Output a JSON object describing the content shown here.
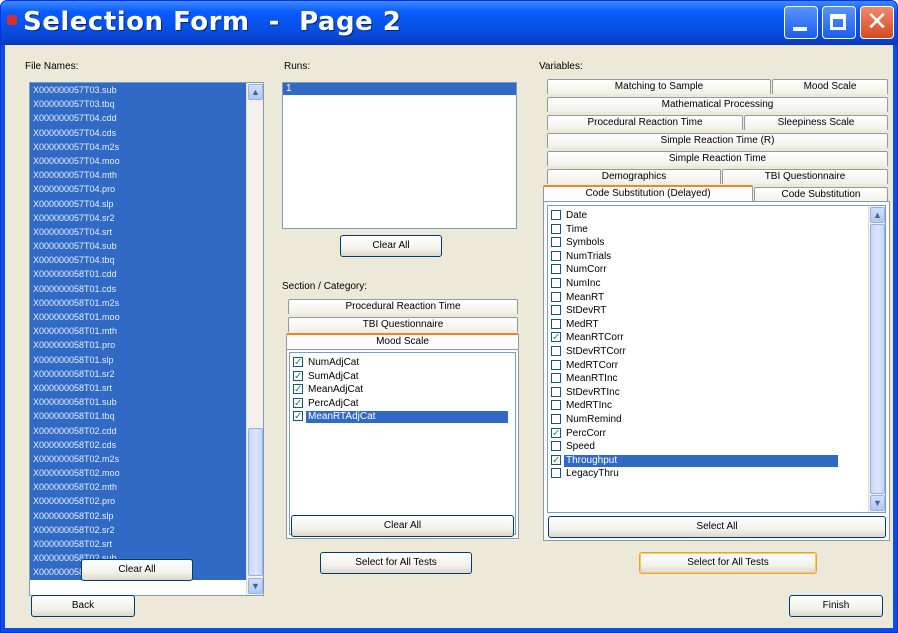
{
  "window": {
    "title": "Selection Form  -  Page 2"
  },
  "files": {
    "label": "File Names:",
    "items": [
      "X000000057T03.sub",
      "X000000057T03.tbq",
      "X000000057T04.cdd",
      "X000000057T04.cds",
      "X000000057T04.m2s",
      "X000000057T04.moo",
      "X000000057T04.mth",
      "X000000057T04.pro",
      "X000000057T04.slp",
      "X000000057T04.sr2",
      "X000000057T04.srt",
      "X000000057T04.sub",
      "X000000057T04.tbq",
      "X000000058T01.cdd",
      "X000000058T01.cds",
      "X000000058T01.m2s",
      "X000000058T01.moo",
      "X000000058T01.mth",
      "X000000058T01.pro",
      "X000000058T01.slp",
      "X000000058T01.sr2",
      "X000000058T01.srt",
      "X000000058T01.sub",
      "X000000058T01.tbq",
      "X000000058T02.cdd",
      "X000000058T02.cds",
      "X000000058T02.m2s",
      "X000000058T02.moo",
      "X000000058T02.mth",
      "X000000058T02.pro",
      "X000000058T02.slp",
      "X000000058T02.sr2",
      "X000000058T02.srt",
      "X000000058T02.sub",
      "X000000058T02.tbq"
    ],
    "clear_label": "Clear All"
  },
  "runs": {
    "label": "Runs:",
    "items": [
      "1"
    ],
    "clear_label": "Clear All"
  },
  "section": {
    "label": "Section / Category:",
    "tabs": [
      "Procedural Reaction Time",
      "TBI Questionnaire",
      "Mood Scale"
    ],
    "items": [
      {
        "label": "NumAdjCat",
        "checked": true
      },
      {
        "label": "SumAdjCat",
        "checked": true
      },
      {
        "label": "MeanAdjCat",
        "checked": true
      },
      {
        "label": "PercAdjCat",
        "checked": true
      },
      {
        "label": "MeanRTAdjCat",
        "checked": true
      }
    ],
    "clear_label": "Clear All",
    "select_all_tests_label": "Select for All Tests"
  },
  "variables": {
    "label": "Variables:",
    "tabs": [
      "Matching to Sample",
      "Mood Scale",
      "Mathematical Processing",
      "Procedural Reaction Time",
      "Sleepiness Scale",
      "Simple Reaction Time (R)",
      "Simple Reaction Time",
      "Demographics",
      "TBI Questionnaire",
      "Code Substitution (Delayed)",
      "Code Substitution"
    ],
    "items": [
      {
        "label": "Date",
        "checked": false
      },
      {
        "label": "Time",
        "checked": false
      },
      {
        "label": "Symbols",
        "checked": false
      },
      {
        "label": "NumTrials",
        "checked": false
      },
      {
        "label": "NumCorr",
        "checked": false
      },
      {
        "label": "NumInc",
        "checked": false
      },
      {
        "label": "MeanRT",
        "checked": false
      },
      {
        "label": "StDevRT",
        "checked": false
      },
      {
        "label": "MedRT",
        "checked": false
      },
      {
        "label": "MeanRTCorr",
        "checked": true
      },
      {
        "label": "StDevRTCorr",
        "checked": false
      },
      {
        "label": "MedRTCorr",
        "checked": false
      },
      {
        "label": "MeanRTInc",
        "checked": false
      },
      {
        "label": "StDevRTInc",
        "checked": false
      },
      {
        "label": "MedRTInc",
        "checked": false
      },
      {
        "label": "NumRemind",
        "checked": false
      },
      {
        "label": "PercCorr",
        "checked": true
      },
      {
        "label": "Speed",
        "checked": false
      },
      {
        "label": "Throughput",
        "checked": true
      },
      {
        "label": "LegacyThru",
        "checked": false
      }
    ],
    "select_all_label": "Select All",
    "select_all_tests_label": "Select for All Tests"
  },
  "nav": {
    "back_label": "Back",
    "finish_label": "Finish"
  },
  "colors": {
    "title_bar": "#0a5bff",
    "selection": "#316ac5",
    "face": "#ece9d8",
    "close_button": "#d24a20",
    "check_mark": "#21a121",
    "active_tab_accent": "#e68b2c"
  }
}
